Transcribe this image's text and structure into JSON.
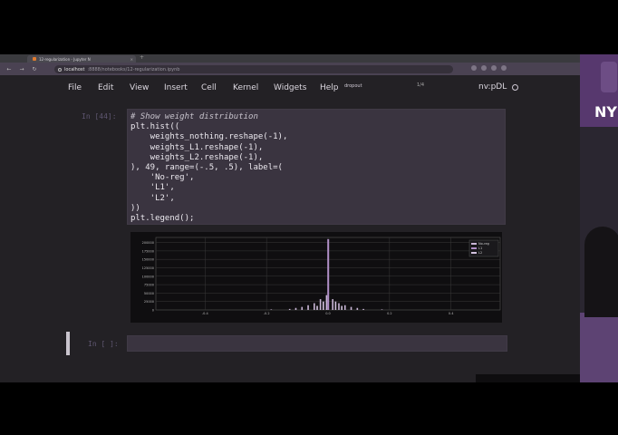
{
  "browser": {
    "tab_title": "12-regularization - Jupyter N",
    "tab_close": "×",
    "new_tab": "+",
    "url_host": "localhost",
    "url_path": ":8888/notebooks/12-regularization.ipynb",
    "nav": [
      "←",
      "→",
      "↻"
    ]
  },
  "menu": {
    "items": [
      "File",
      "Edit",
      "View",
      "Insert",
      "Cell",
      "Kernel",
      "Widgets",
      "Help"
    ],
    "dropout_label": "dropout",
    "dropout_value": "1/4",
    "kernel": "nv:pDL"
  },
  "cell": {
    "prompt": "In [44]:",
    "lines": [
      "# Show weight distribution",
      "plt.hist((",
      "    weights_nothing.reshape(-1),",
      "    weights_L1.reshape(-1),",
      "    weights_L2.reshape(-1),",
      "), 49, range=(-.5, .5), label=(",
      "    'No-reg',",
      "    'L1',",
      "    'L2',",
      "))",
      "plt.legend();"
    ]
  },
  "empty_cell": {
    "prompt": "In [ ]:"
  },
  "side_logo": "NY",
  "colors": {
    "bar_main": "#c9b6d6",
    "bar_l1": "#b08fc7",
    "bar_l2": "#d3c3df"
  },
  "chart_data": {
    "type": "bar",
    "x_ticks": [
      "-0.4",
      "-0.2",
      "0.0",
      "0.2",
      "0.4"
    ],
    "y_ticks": [
      "0",
      "25000",
      "50000",
      "75000",
      "100000",
      "125000",
      "150000",
      "175000",
      "200000"
    ],
    "ylim": [
      0,
      215000
    ],
    "xlim": [
      -0.56,
      0.56
    ],
    "legend": [
      "No-reg",
      "L1",
      "L2"
    ],
    "legend_position": "top-right",
    "grid": true,
    "series": [
      {
        "name": "No-reg",
        "x": [
          -0.18,
          -0.12,
          -0.1,
          -0.08,
          -0.06,
          -0.04,
          -0.02,
          0.0,
          0.02,
          0.04,
          0.06,
          0.08,
          0.1,
          0.12,
          0.18
        ],
        "values": [
          1500,
          3000,
          6000,
          9000,
          14000,
          20000,
          32000,
          44000,
          32000,
          20000,
          14000,
          9000,
          6000,
          3000,
          1500
        ]
      },
      {
        "name": "L1",
        "x": [
          0.0
        ],
        "values": [
          210000
        ]
      },
      {
        "name": "L2",
        "x": [
          -0.04,
          -0.02,
          0.02,
          0.04
        ],
        "values": [
          12000,
          25000,
          25000,
          12000
        ]
      }
    ]
  }
}
